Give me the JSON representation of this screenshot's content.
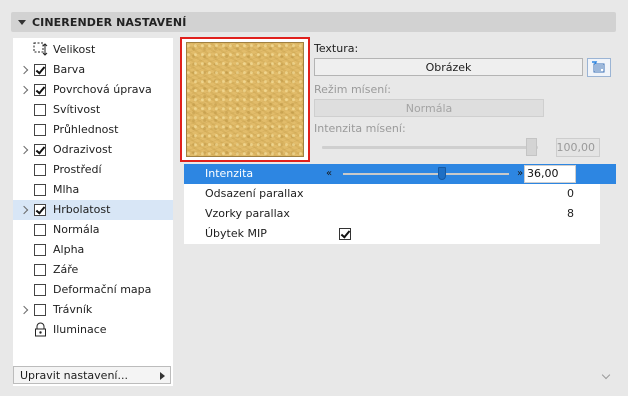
{
  "panel": {
    "title": "CINERENDER NASTAVENÍ"
  },
  "tree": {
    "items": [
      {
        "label": "Velikost",
        "arrow": false,
        "kind": "icon",
        "icon": "resize-icon",
        "checked": false
      },
      {
        "label": "Barva",
        "arrow": true,
        "kind": "checkbox",
        "checked": true
      },
      {
        "label": "Povrchová úprava",
        "arrow": true,
        "kind": "checkbox",
        "checked": true
      },
      {
        "label": "Svítivost",
        "arrow": false,
        "kind": "checkbox",
        "checked": false
      },
      {
        "label": "Průhlednost",
        "arrow": false,
        "kind": "checkbox",
        "checked": false
      },
      {
        "label": "Odrazivost",
        "arrow": true,
        "kind": "checkbox",
        "checked": true
      },
      {
        "label": "Prostředí",
        "arrow": false,
        "kind": "checkbox",
        "checked": false
      },
      {
        "label": "Mlha",
        "arrow": false,
        "kind": "checkbox",
        "checked": false
      },
      {
        "label": "Hrbolatost",
        "arrow": true,
        "kind": "checkbox",
        "checked": true,
        "selected": true
      },
      {
        "label": "Normála",
        "arrow": false,
        "kind": "checkbox",
        "checked": false
      },
      {
        "label": "Alpha",
        "arrow": false,
        "kind": "checkbox",
        "checked": false
      },
      {
        "label": "Záře",
        "arrow": false,
        "kind": "checkbox",
        "checked": false
      },
      {
        "label": "Deformační mapa",
        "arrow": false,
        "kind": "checkbox",
        "checked": false
      },
      {
        "label": "Trávník",
        "arrow": true,
        "kind": "checkbox",
        "checked": false
      },
      {
        "label": "Iluminace",
        "arrow": false,
        "kind": "icon",
        "icon": "lock-icon",
        "checked": false
      }
    ],
    "edit_button": "Upravit nastavení..."
  },
  "texture": {
    "label": "Textura:",
    "type_value": "Obrázek",
    "blend_mode_label": "Režim mísení:",
    "blend_mode_value": "Normála",
    "blend_intensity_label": "Intenzita mísení:",
    "blend_intensity_value": "100,00",
    "blend_intensity_fraction": 1.0
  },
  "properties": {
    "intensity": {
      "label": "Intenzita",
      "value": "36,00"
    },
    "parallax_offset": {
      "label": "Odsazení parallax",
      "value": "0"
    },
    "parallax_samples": {
      "label": "Vzorky parallax",
      "value": "8"
    },
    "mip_falloff": {
      "label": "Úbytek MIP",
      "checked": true
    }
  },
  "colors": {
    "accent": "#2d86e2",
    "highlight_frame": "#e0201c",
    "selection": "#d8e6f6"
  }
}
